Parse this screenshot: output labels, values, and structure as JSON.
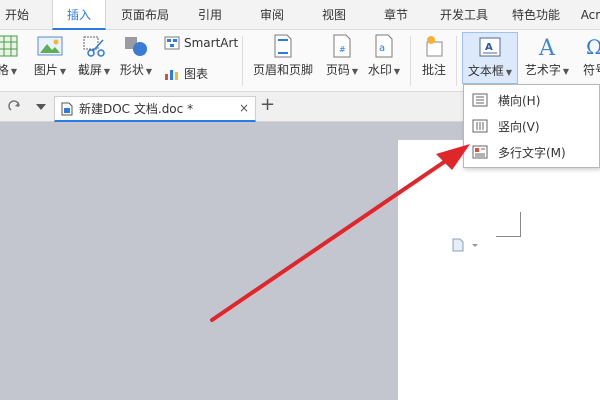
{
  "menu_tabs": [
    "开始",
    "插入",
    "页面布局",
    "引用",
    "审阅",
    "视图",
    "章节",
    "开发工具",
    "特色功能",
    "Acro"
  ],
  "active_tab": "插入",
  "ribbon": {
    "table_label": "格",
    "picture_label": "图片",
    "screenshot_label": "截屏",
    "shape_label": "形状",
    "smartart_label": "SmartArt",
    "chart_label": "图表",
    "header_footer_label": "页眉和页脚",
    "page_number_label": "页码",
    "watermark_label": "水印",
    "comment_label": "批注",
    "textbox_label": "文本框",
    "wordart_label": "艺术字",
    "symbol_label": "符号"
  },
  "doc_tab": {
    "name": "新建DOC 文档.doc *",
    "close": "×",
    "new_tab": "+"
  },
  "textbox_menu": {
    "items": [
      {
        "label": "横向(H)"
      },
      {
        "label": "竖向(V)"
      },
      {
        "label": "多行文字(M)"
      }
    ]
  },
  "colors": {
    "accent": "#2b7be4",
    "arrow": "#e0262a",
    "workspace": "#c3c6cf"
  }
}
